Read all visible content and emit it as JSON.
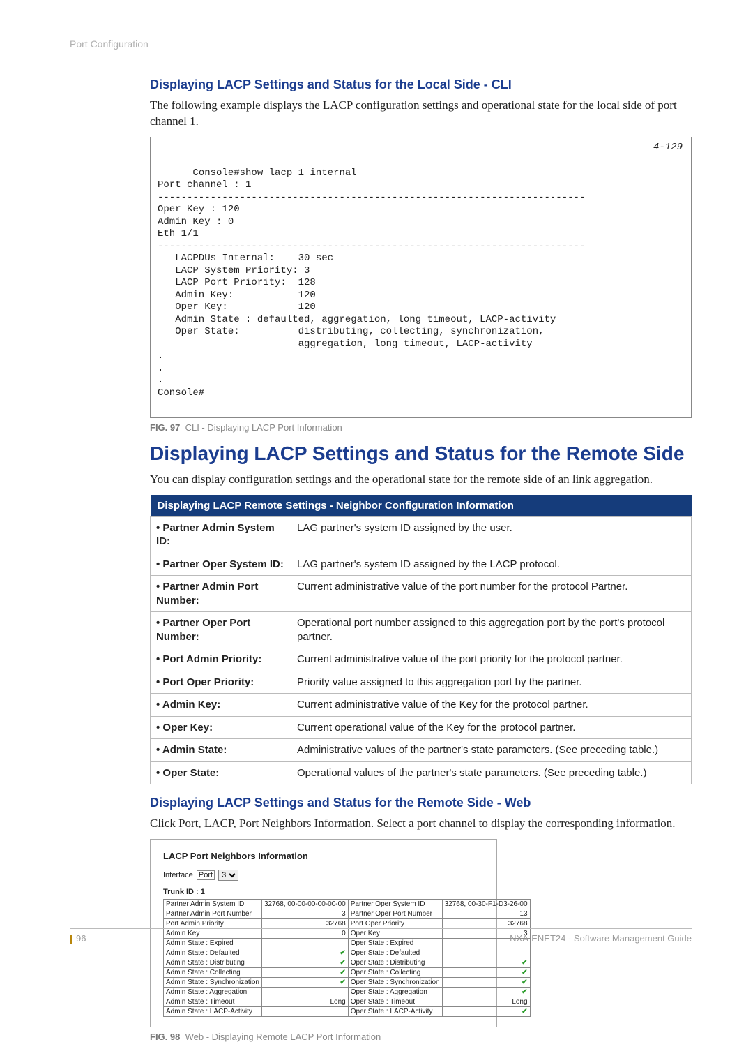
{
  "running_head": "Port Configuration",
  "section1": {
    "title": "Displaying LACP Settings and Status for the Local Side - CLI",
    "intro": "The following example displays the LACP configuration settings and operational state for the local side of port channel 1."
  },
  "cli": {
    "ref": "4-129",
    "text": "Console#show lacp 1 internal\nPort channel : 1\n-------------------------------------------------------------------------\nOper Key : 120\nAdmin Key : 0\nEth 1/1\n-------------------------------------------------------------------------\n   LACPDUs Internal:    30 sec\n   LACP System Priority: 3\n   LACP Port Priority:  128\n   Admin Key:           120\n   Oper Key:            120\n   Admin State : defaulted, aggregation, long timeout, LACP-activity\n   Oper State:          distributing, collecting, synchronization,\n                        aggregation, long timeout, LACP-activity\n.\n.\n.\nConsole#"
  },
  "fig97": {
    "label": "FIG. 97",
    "text": "CLI - Displaying LACP Port Information"
  },
  "big_head": "Displaying LACP Settings and Status for the Remote Side",
  "remote_intro": "You can display configuration settings and the operational state for the remote side of an link aggregation.",
  "table_header": "Displaying LACP Remote Settings - Neighbor Configuration Information",
  "rows": [
    {
      "label": "Partner Admin System ID:",
      "desc": "LAG partner's system ID assigned by the user."
    },
    {
      "label": "Partner Oper System ID:",
      "desc": "LAG partner's system ID assigned by the LACP protocol."
    },
    {
      "label": "Partner Admin Port Number:",
      "desc": "Current administrative value of the port number for the protocol Partner."
    },
    {
      "label": "Partner Oper Port Number:",
      "desc": "Operational port number assigned to this aggregation port by the port's protocol partner."
    },
    {
      "label": "Port Admin Priority:",
      "desc": "Current administrative value of the port priority for the protocol partner."
    },
    {
      "label": "Port Oper Priority:",
      "desc": "Priority value assigned to this aggregation port by the partner."
    },
    {
      "label": "Admin Key:",
      "desc": "Current administrative value of the Key for the protocol partner."
    },
    {
      "label": "Oper Key:",
      "desc": "Current operational value of the Key for the protocol partner."
    },
    {
      "label": "Admin State:",
      "desc": "Administrative values of the partner's state parameters. (See preceding table.)"
    },
    {
      "label": "Oper State:",
      "desc": "Operational values of the partner's state parameters. (See preceding table.)"
    }
  ],
  "section_web": {
    "title": "Displaying LACP Settings and Status for the Remote Side - Web",
    "intro": "Click Port, LACP, Port Neighbors Information. Select a port channel to display the corresponding information."
  },
  "webshot": {
    "title": "LACP Port Neighbors Information",
    "iface_label": "Interface",
    "iface_kind": "Port",
    "iface_value": "3",
    "trunk": "Trunk ID : 1",
    "pairs": [
      {
        "l": "Partner Admin System ID",
        "lv": "32768, 00-00-00-00-00-00",
        "r": "Partner Oper System ID",
        "rv": "32768, 00-30-F1-D3-26-00"
      },
      {
        "l": "Partner Admin Port Number",
        "lv": "3",
        "r": "Partner Oper Port Number",
        "rv": "13"
      },
      {
        "l": "Port Admin Priority",
        "lv": "32768",
        "r": "Port Oper Priority",
        "rv": "32768"
      },
      {
        "l": "Admin Key",
        "lv": "0",
        "r": "Oper Key",
        "rv": "3"
      },
      {
        "l": "Admin State : Expired",
        "lv": "",
        "r": "Oper State : Expired",
        "rv": ""
      },
      {
        "l": "Admin State : Defaulted",
        "lv": "check",
        "r": "Oper State : Defaulted",
        "rv": ""
      },
      {
        "l": "Admin State : Distributing",
        "lv": "check",
        "r": "Oper State : Distributing",
        "rv": "check"
      },
      {
        "l": "Admin State : Collecting",
        "lv": "check",
        "r": "Oper State : Collecting",
        "rv": "check"
      },
      {
        "l": "Admin State : Synchronization",
        "lv": "check",
        "r": "Oper State : Synchronization",
        "rv": "check"
      },
      {
        "l": "Admin State : Aggregation",
        "lv": "",
        "r": "Oper State : Aggregation",
        "rv": "check"
      },
      {
        "l": "Admin State : Timeout",
        "lv": "Long",
        "r": "Oper State : Timeout",
        "rv": "Long"
      },
      {
        "l": "Admin State : LACP-Activity",
        "lv": "",
        "r": "Oper State : LACP-Activity",
        "rv": "check"
      }
    ]
  },
  "fig98": {
    "label": "FIG. 98",
    "text": "Web - Displaying Remote LACP Port Information"
  },
  "footer": {
    "page": "96",
    "doc": "NXA-ENET24 - Software Management Guide"
  }
}
